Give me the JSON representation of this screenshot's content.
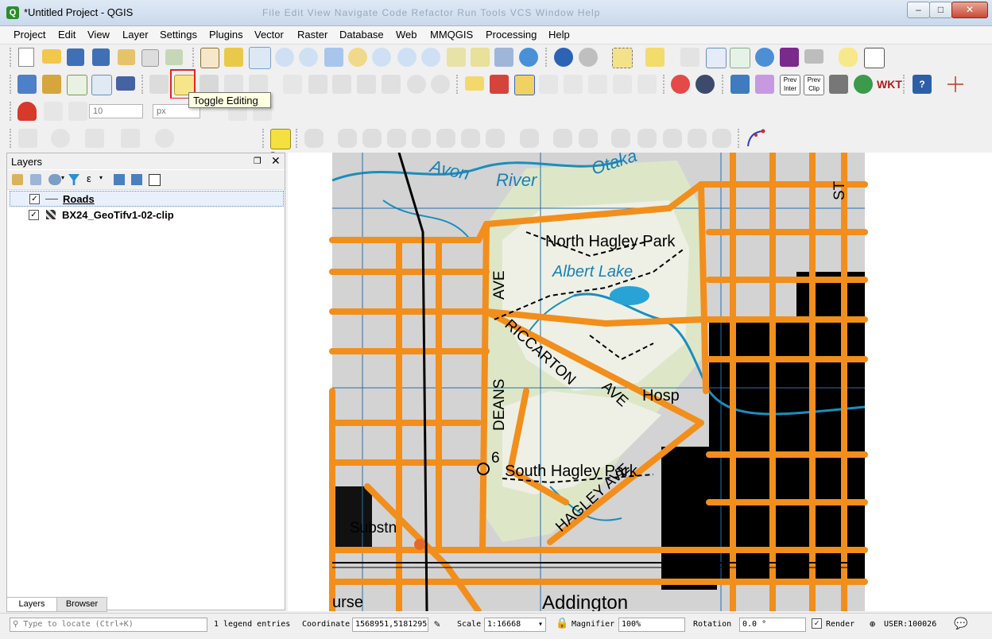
{
  "window": {
    "title": "*Untitled Project - QGIS",
    "ghost_menu": "File   Edit   View   Navigate   Code   Refactor   Run   Tools   VCS   Window   Help",
    "minimize": "‒",
    "maximize": "□",
    "close": "✕"
  },
  "menu": [
    "Project",
    "Edit",
    "View",
    "Layer",
    "Settings",
    "Plugins",
    "Vector",
    "Raster",
    "Database",
    "Web",
    "MMQGIS",
    "Processing",
    "Help"
  ],
  "toolbar": {
    "tooltip": "Toggle Editing",
    "snapping_tolerance": "10",
    "snapping_units": "px",
    "prev_inter_label": "Prev Inter",
    "prev_clip_label": "Prev Clip",
    "wkt_label": "WKT"
  },
  "layers_panel": {
    "title": "Layers",
    "items": [
      {
        "name": "Roads",
        "checked": true,
        "icon": "line-layer-icon"
      },
      {
        "name": "BX24_GeoTifv1-02-clip",
        "checked": true,
        "icon": "raster-layer-icon"
      }
    ],
    "tabs": [
      "Layers",
      "Browser"
    ]
  },
  "map": {
    "labels": {
      "avon": "Avon",
      "river": "River",
      "otakaro": "Otaka",
      "north_hagley": "North Hagley Park",
      "albert_lake": "Albert Lake",
      "ave_vertical": "AVE",
      "riccarton": "RICCARTON",
      "ave2": "AVE",
      "hosp": "Hosp",
      "deans": "DEANS",
      "six": "6",
      "south_hagley": "South Hagley Park",
      "hagley_ave": "HAGLEY AVE",
      "substn": "Substn",
      "addington": "Addington",
      "course": "urse",
      "st": "ST"
    }
  },
  "status": {
    "locate_placeholder": "Type to locate (Ctrl+K)",
    "legend_entries": "1 legend entries",
    "coordinate_label": "Coordinate",
    "coordinate_value": "1568951,5181295",
    "scale_label": "Scale",
    "scale_value": "1:16668",
    "magnifier_label": "Magnifier",
    "magnifier_value": "100%",
    "rotation_label": "Rotation",
    "rotation_value": "0.0 °",
    "render_label": "Render",
    "crs": "USER:100026"
  }
}
